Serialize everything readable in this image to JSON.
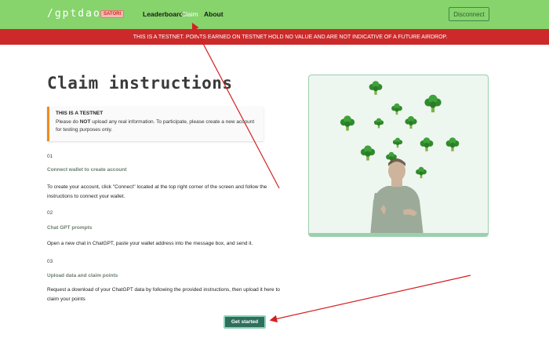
{
  "nav": {
    "logo": "/gptdao",
    "badge": "SATORI",
    "links": [
      "Leaderboard",
      "Claim",
      "About"
    ],
    "disconnect": "Disconnect"
  },
  "banner": {
    "text": "THIS IS A TESTNET. POINTS EARNED ON TESTNET HOLD NO VALUE AND ARE NOT INDICATIVE OF A FUTURE AIRDROP."
  },
  "main": {
    "title": "Claim instructions",
    "warning": {
      "title": "THIS IS A TESTNET",
      "body_pre": "Please do ",
      "body_bold": "NOT",
      "body_post": " upload any real information. To participate, please create a new account for testing purposes only."
    },
    "steps": [
      {
        "num": "01",
        "title": "Connect wallet to create account",
        "text": "To create your account, click \"Connect\" located at the top right corner of the screen and follow the instructions to connect your wallet."
      },
      {
        "num": "02",
        "title": "Chat GPT prompts",
        "text": "Open a new chat in ChatGPT, paste your wallet address into the message box, and send it."
      },
      {
        "num": "03",
        "title": "Upload data and claim points",
        "text": "Request a download of your ChatGPT data by following the provided instructions, then upload it here to claim your points"
      }
    ],
    "cta": "Get started"
  },
  "illustration": {
    "icon": "broccoli-icon",
    "subject": "person-figure"
  },
  "colors": {
    "nav_bg": "#86d46b",
    "banner_bg": "#cc2a2a",
    "cta_bg": "#2e6f5c",
    "warning_accent": "#f28a1c",
    "arrow": "#d42020"
  }
}
